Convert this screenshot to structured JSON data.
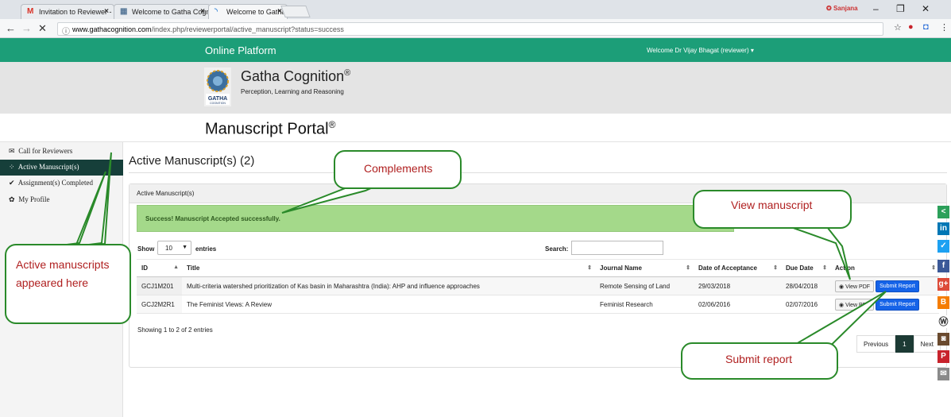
{
  "browser": {
    "tabs": [
      {
        "icon": "gmail-icon",
        "title": "Invitation to Reviewer - I"
      },
      {
        "icon": "page-icon",
        "title": "Welcome to Gatha Cogni"
      },
      {
        "icon": "loading-icon",
        "title": "Welcome to Gatha Cogni"
      }
    ],
    "url_host": "www.gathacognition.com",
    "url_path": "/index.php/reviewerportal/active_manuscript?status=success",
    "user_badge": "Sanjana"
  },
  "header": {
    "platform_label": "Online Platform",
    "welcome_text": "Welcome Dr Vijay Bhagat (reviewer) ▾",
    "brand_title": "Gatha Cognition",
    "brand_reg": "®",
    "brand_subtitle": "Perception, Learning and Reasoning",
    "logo_text": "GATHA COGNITION",
    "portal_title": "Manuscript Portal",
    "portal_reg": "®",
    "accent": "#1c9e78"
  },
  "sidebar": {
    "items": [
      {
        "icon": "envelope-icon",
        "label": "Call for Reviewers"
      },
      {
        "icon": "spinner-icon",
        "label": "Active Manuscript(s)",
        "active": true
      },
      {
        "icon": "check-icon",
        "label": "Assignment(s) Completed"
      },
      {
        "icon": "gear-icon",
        "label": "My Profile"
      }
    ]
  },
  "main": {
    "heading": "Active Manuscript(s) (2)",
    "panel_title": "Active Manuscript(s)",
    "alert_text": "Success! Manuscript Accepted successfully.",
    "show_label": "Show",
    "entries_value": "10",
    "entries_label": "entries",
    "search_label": "Search:",
    "columns": [
      "ID",
      "Title",
      "Journal Name",
      "Date of Acceptance",
      "Due Date",
      "Action"
    ],
    "rows": [
      {
        "id": "GCJ1M201",
        "title": "Multi-criteria watershed prioritization of Kas basin in Maharashtra (India): AHP and influence approaches",
        "journal": "Remote Sensing of Land",
        "accepted": "29/03/2018",
        "due": "28/04/2018"
      },
      {
        "id": "GCJ2M2R1",
        "title": "The Feminist Views: A Review",
        "journal": "Feminist Research",
        "accepted": "02/06/2016",
        "due": "02/07/2016"
      }
    ],
    "view_pdf_label": "View PDF",
    "submit_report_label": "Submit Report",
    "showing_text": "Showing 1 to 2 of 2 entries",
    "pager": {
      "previous": "Previous",
      "current": "1",
      "next": "Next"
    }
  },
  "annotations": {
    "complements": "Complements",
    "view_manuscript": "View manuscript",
    "active_manuscripts": "Active manuscripts appeared here",
    "submit_report": "Submit report",
    "color": "#2a8a2a",
    "text_color": "#b02020"
  },
  "social": [
    "share-icon",
    "linkedin-icon",
    "twitter-icon",
    "facebook-icon",
    "google-plus-icon",
    "blogger-icon",
    "wordpress-icon",
    "instagram-icon",
    "pinterest-icon",
    "email-icon"
  ]
}
